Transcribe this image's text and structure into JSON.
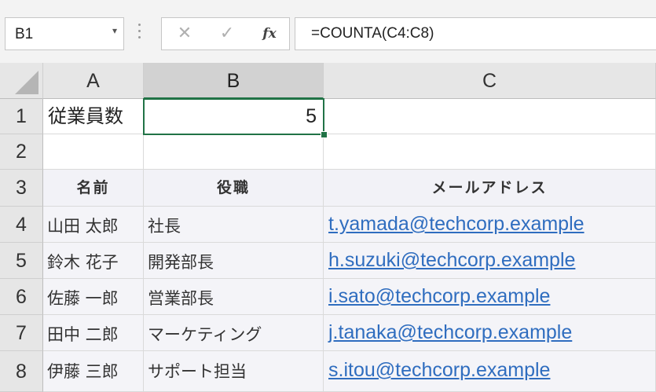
{
  "formula_bar": {
    "name_box": "B1",
    "name_box_arrow": "▾",
    "cancel_icon": "✕",
    "enter_icon": "✓",
    "fx_label": "fx",
    "formula": "=COUNTA(C4:C8)"
  },
  "columns": [
    "A",
    "B",
    "C"
  ],
  "rows": [
    "1",
    "2",
    "3",
    "4",
    "5",
    "6",
    "7",
    "8"
  ],
  "sheet": {
    "a1": "従業員数",
    "b1": "5",
    "headers": [
      "名前",
      "役職",
      "メールアドレス"
    ],
    "records": [
      {
        "name": "山田 太郎",
        "title": "社長",
        "email": "t.yamada@techcorp.example"
      },
      {
        "name": "鈴木 花子",
        "title": "開発部長",
        "email": "h.suzuki@techcorp.example"
      },
      {
        "name": "佐藤 一郎",
        "title": "営業部長",
        "email": "i.sato@techcorp.example"
      },
      {
        "name": "田中 二郎",
        "title": "マーケティング",
        "email": "j.tanaka@techcorp.example"
      },
      {
        "name": "伊藤 三郎",
        "title": "サポート担当",
        "email": "s.itou@techcorp.example"
      }
    ]
  },
  "colors": {
    "selection": "#217346",
    "hyperlink": "#2f6dbf",
    "table_fill": "#f4f4f8"
  }
}
